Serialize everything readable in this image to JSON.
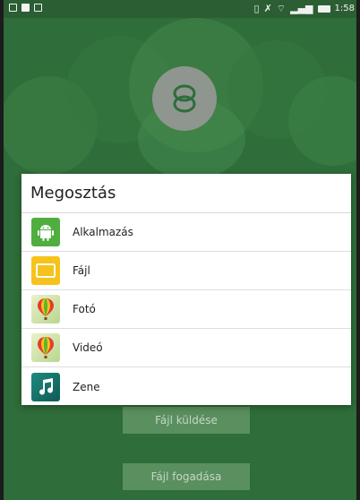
{
  "status_bar": {
    "time": "1:58"
  },
  "share_dialog": {
    "title": "Megosztás",
    "items": [
      {
        "label": "Alkalmazás",
        "icon": "android-app-icon"
      },
      {
        "label": "Fájl",
        "icon": "folder-icon"
      },
      {
        "label": "Fotó",
        "icon": "photo-balloon-icon"
      },
      {
        "label": "Videó",
        "icon": "video-balloon-icon"
      },
      {
        "label": "Zene",
        "icon": "music-note-icon"
      }
    ]
  },
  "background_buttons": {
    "send_label": "Fájl küldése",
    "receive_label": "Fájl fogadása"
  },
  "colors": {
    "background": "#2f6d3a",
    "dialog": "#ffffff",
    "android": "#4fae3f",
    "folder": "#f6c21c"
  }
}
